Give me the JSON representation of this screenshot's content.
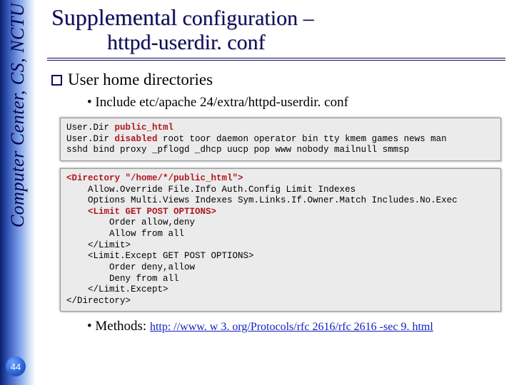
{
  "sidebar": {
    "vertical_text": "Computer Center, CS, NCTU",
    "page_number": "44"
  },
  "title": {
    "main": "Supplemental",
    "sub1": " configuration –",
    "line2": "httpd-userdir. conf"
  },
  "section": {
    "heading": "User home directories",
    "bullet1": "Include etc/apache 24/extra/httpd-userdir. conf"
  },
  "code1": {
    "l1a": "User.Dir ",
    "l1b": "public_html",
    "l2a": "User.Dir ",
    "l2b": "disabled",
    "l2c": " root toor daemon operator bin tty kmem games news man",
    "l3": "sshd bind proxy _pflogd _dhcp uucp pop www nobody mailnull smmsp"
  },
  "code2": {
    "l1a": "<Directory ",
    "l1b": "\"/home/*/public_html\">",
    "l2": "    Allow.Override File.Info Auth.Config Limit Indexes",
    "l3": "    Options Multi.Views Indexes Sym.Links.If.Owner.Match Includes.No.Exec",
    "l4a": "    ",
    "l4b": "<Limit GET POST OPTIONS>",
    "l5": "        Order allow,deny",
    "l6": "        Allow from all",
    "l7": "    </Limit>",
    "l8": "    <Limit.Except GET POST OPTIONS>",
    "l9": "        Order deny,allow",
    "l10": "        Deny from all",
    "l11": "    </Limit.Except>",
    "l12": "</Directory>"
  },
  "methods": {
    "label": "Methods: ",
    "url": "http: //www. w 3. org/Protocols/rfc 2616/rfc 2616 -sec 9. html"
  }
}
